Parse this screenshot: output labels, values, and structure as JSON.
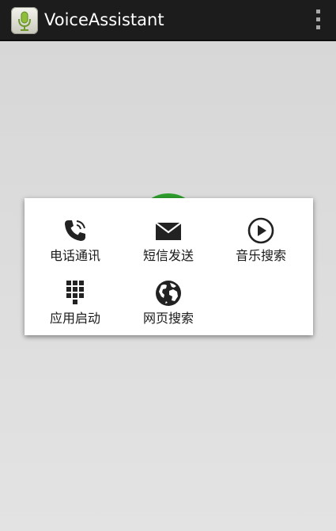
{
  "action_bar": {
    "title": "VoiceAssistant",
    "app_icon": "microphone-icon",
    "overflow_icon": "overflow-menu-icon"
  },
  "main": {
    "mic_button_icon": "microphone-icon",
    "mic_button_color": "#2e9e2e"
  },
  "menu": {
    "items": [
      {
        "label": "电话通讯",
        "icon": "phone-icon"
      },
      {
        "label": "短信发送",
        "icon": "envelope-icon"
      },
      {
        "label": "音乐搜索",
        "icon": "play-icon"
      },
      {
        "label": "应用启动",
        "icon": "app-grid-icon"
      },
      {
        "label": "网页搜索",
        "icon": "globe-icon"
      }
    ]
  },
  "colors": {
    "action_bar": "#1c1c1c",
    "background": "#dcdcdc",
    "popup": "#ffffff",
    "icon": "#222222"
  }
}
